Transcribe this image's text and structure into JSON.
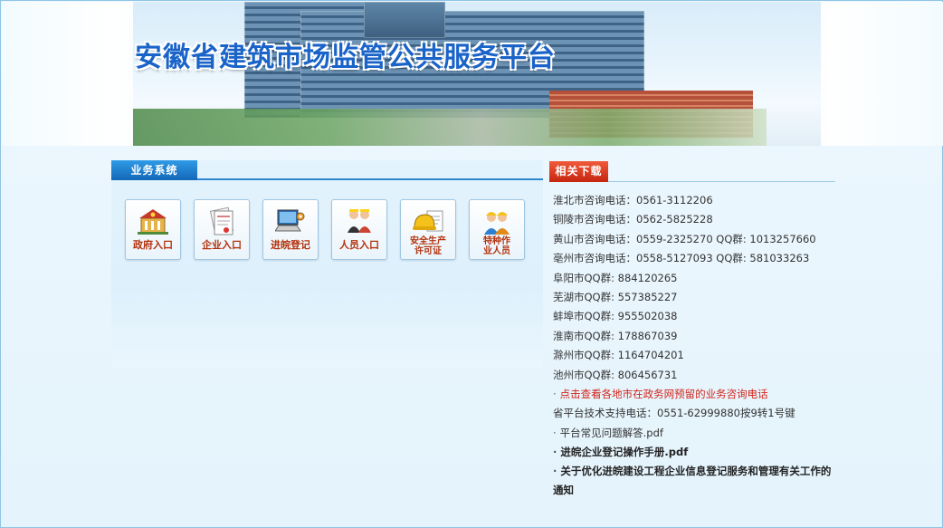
{
  "banner": {
    "title": "安徽省建筑市场监管公共服务平台"
  },
  "business": {
    "heading": "业务系统",
    "buttons": [
      {
        "name": "government-entry-button",
        "icon": "government-building-icon",
        "label": "政府入口"
      },
      {
        "name": "enterprise-entry-button",
        "icon": "enterprise-document-icon",
        "label": "企业入口"
      },
      {
        "name": "enter-anhui-registration-button",
        "icon": "computer-registration-icon",
        "label": "进皖登记"
      },
      {
        "name": "personnel-entry-button",
        "icon": "personnel-icon",
        "label": "人员入口"
      },
      {
        "name": "safety-production-permit-button",
        "icon": "safety-helmet-icon",
        "label": "安全生产许可证"
      },
      {
        "name": "special-operations-personnel-button",
        "icon": "workers-icon",
        "label": "特种作业人员"
      }
    ]
  },
  "downloads": {
    "heading": "相关下载",
    "items": [
      {
        "text": "淮北市咨询电话：0561-3112206",
        "style": "plain"
      },
      {
        "text": "铜陵市咨询电话：0562-5825228",
        "style": "plain"
      },
      {
        "text": "黄山市咨询电话：0559-2325270  QQ群: 1013257660",
        "style": "plain"
      },
      {
        "text": "亳州市咨询电话：0558-5127093  QQ群: 581033263",
        "style": "plain"
      },
      {
        "text": "阜阳市QQ群: 884120265",
        "style": "plain"
      },
      {
        "text": "芜湖市QQ群: 557385227",
        "style": "plain"
      },
      {
        "text": "蚌埠市QQ群: 955502038",
        "style": "plain"
      },
      {
        "text": "淮南市QQ群: 178867039",
        "style": "plain"
      },
      {
        "text": "滁州市QQ群: 1164704201",
        "style": "plain"
      },
      {
        "text": "池州市QQ群: 806456731",
        "style": "plain"
      },
      {
        "text": "点击查看各地市在政务网预留的业务咨询电话",
        "style": "red-link"
      },
      {
        "text": "省平台技术支持电话：0551-62999880按9转1号键",
        "style": "plain"
      },
      {
        "text": "平台常见问题解答.pdf",
        "style": "link"
      },
      {
        "text": "进皖企业登记操作手册.pdf",
        "style": "bold-link"
      },
      {
        "text": "关于优化进皖建设工程企业信息登记服务和管理有关工作的通知",
        "style": "bold-wrap"
      }
    ]
  }
}
